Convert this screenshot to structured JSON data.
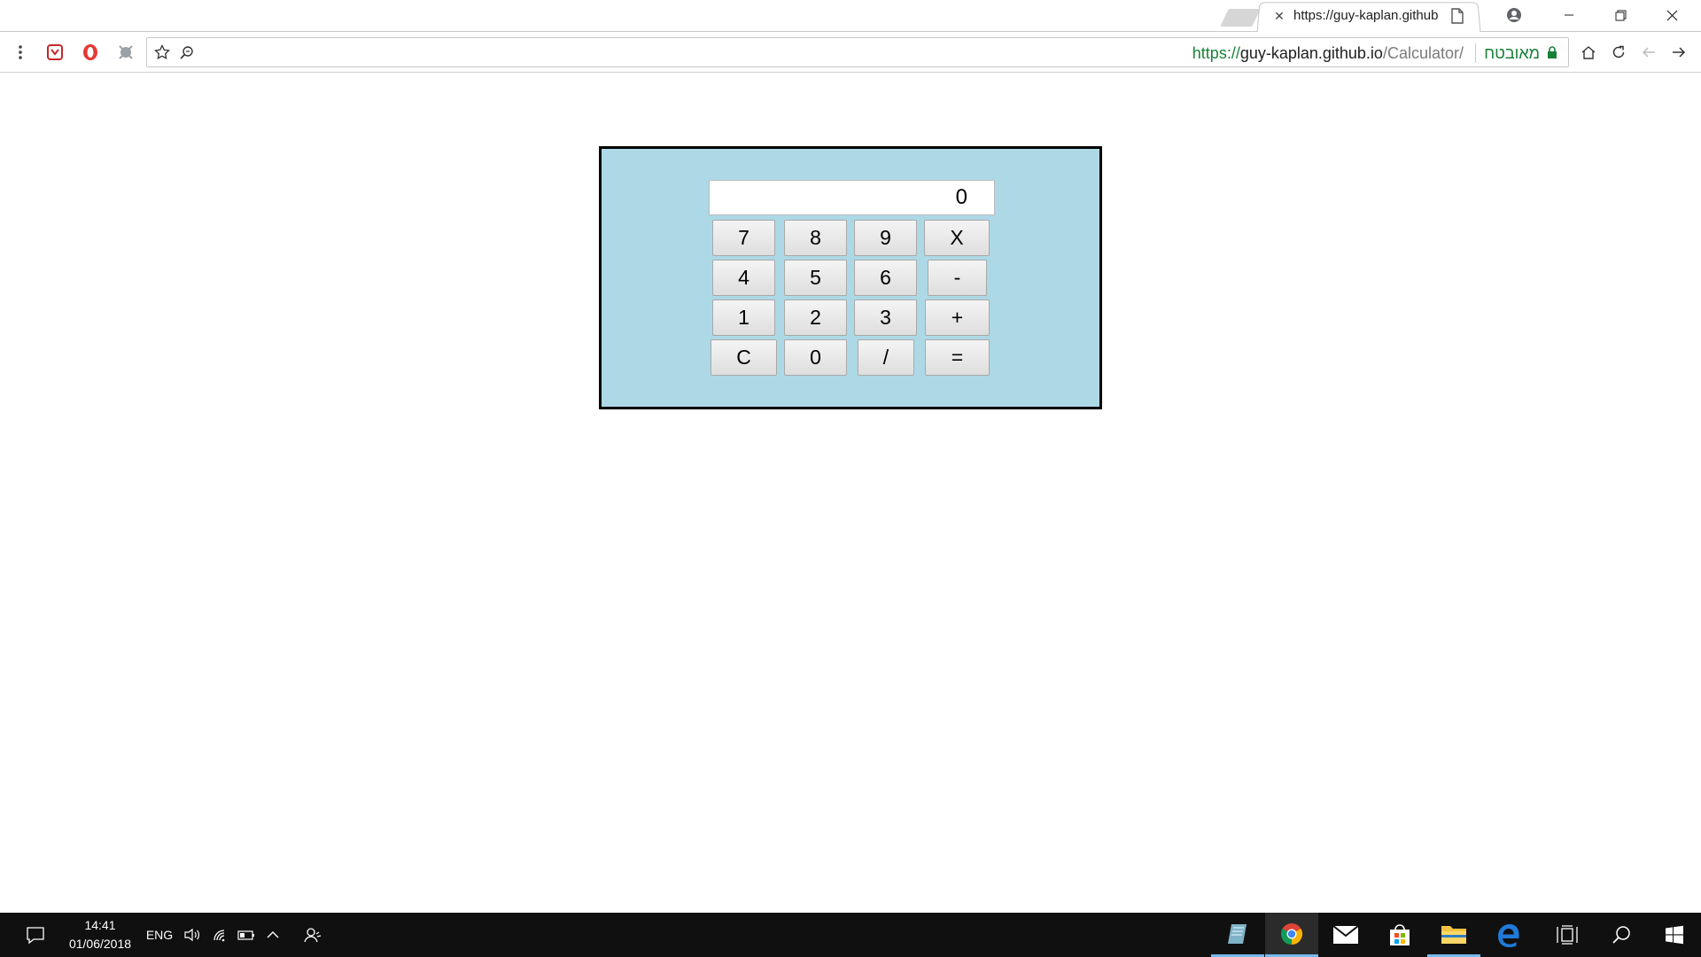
{
  "browser": {
    "tab": {
      "title": "https://guy-kaplan.github"
    },
    "address_bar": {
      "scheme": "https://",
      "host": "guy-kaplan.github.io",
      "path": "/Calculator/",
      "security_label": "מאובטח"
    }
  },
  "calculator": {
    "display": "0",
    "rows": [
      [
        "7",
        "8",
        "9",
        "X"
      ],
      [
        "4",
        "5",
        "6",
        "-"
      ],
      [
        "1",
        "2",
        "3",
        "+"
      ],
      [
        "C",
        "0",
        "/",
        "="
      ]
    ]
  },
  "taskbar": {
    "time": "14:41",
    "date": "01/06/2018",
    "language": "ENG"
  },
  "colors": {
    "calculator_background": "#add8e6",
    "secure_green": "#188038",
    "taskbar": "#101010"
  }
}
